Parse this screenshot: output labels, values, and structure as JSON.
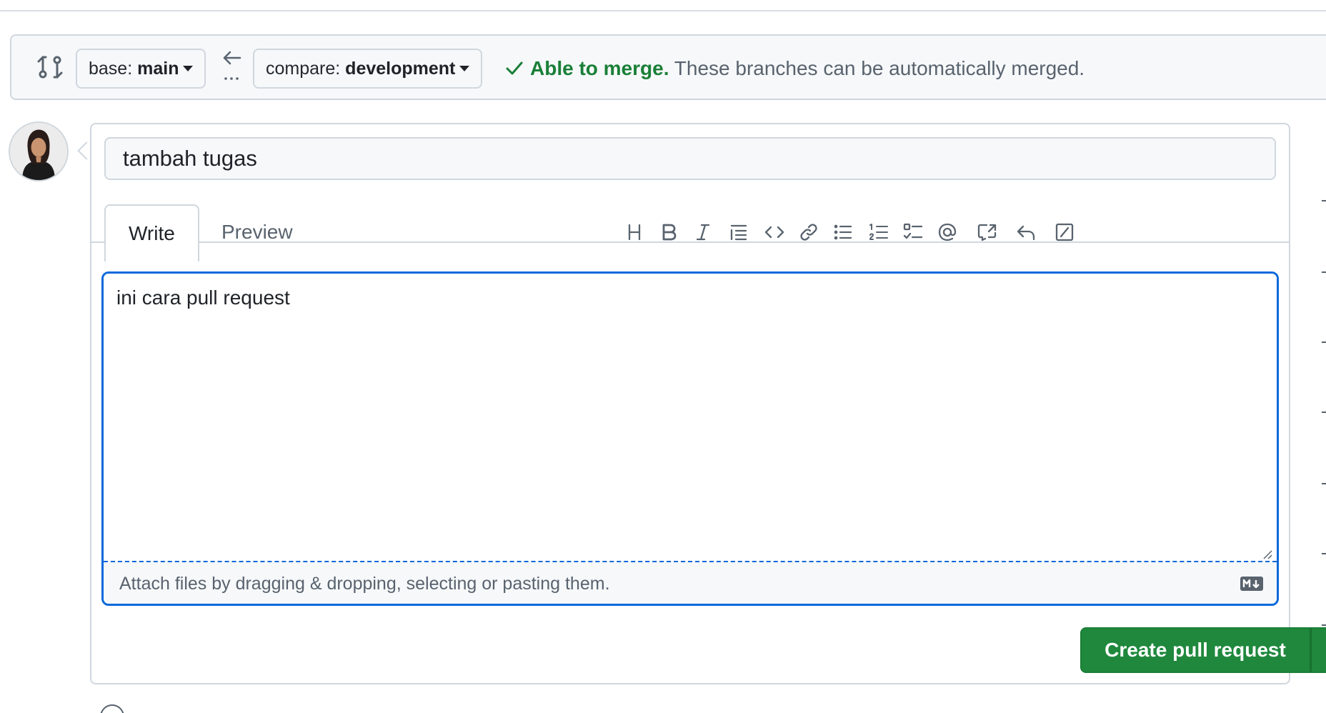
{
  "compare": {
    "base_prefix": "base: ",
    "base_branch": "main",
    "compare_prefix": "compare: ",
    "compare_branch": "development",
    "merge_ok": "Able to merge.",
    "merge_desc": "These branches can be automatically merged."
  },
  "pr": {
    "title": "tambah tugas",
    "body": "ini cara pull request"
  },
  "tabs": {
    "write": "Write",
    "preview": "Preview"
  },
  "toolbar": {
    "icons": [
      "heading-icon",
      "bold-icon",
      "italic-icon",
      "quote-icon",
      "code-icon",
      "link-icon",
      "bulleted-list-icon",
      "numbered-list-icon",
      "task-list-icon",
      "mention-icon",
      "cross-reference-icon",
      "reply-icon",
      "slash-command-icon"
    ]
  },
  "editor": {
    "attach_hint": "Attach files by dragging & dropping, selecting or pasting them."
  },
  "actions": {
    "create_label": "Create pull request"
  },
  "colors": {
    "accent_blue": "#0969da",
    "success_green": "#1a7f37",
    "button_green": "#1f883d",
    "muted_text": "#59636e",
    "border": "#d0d7de"
  }
}
